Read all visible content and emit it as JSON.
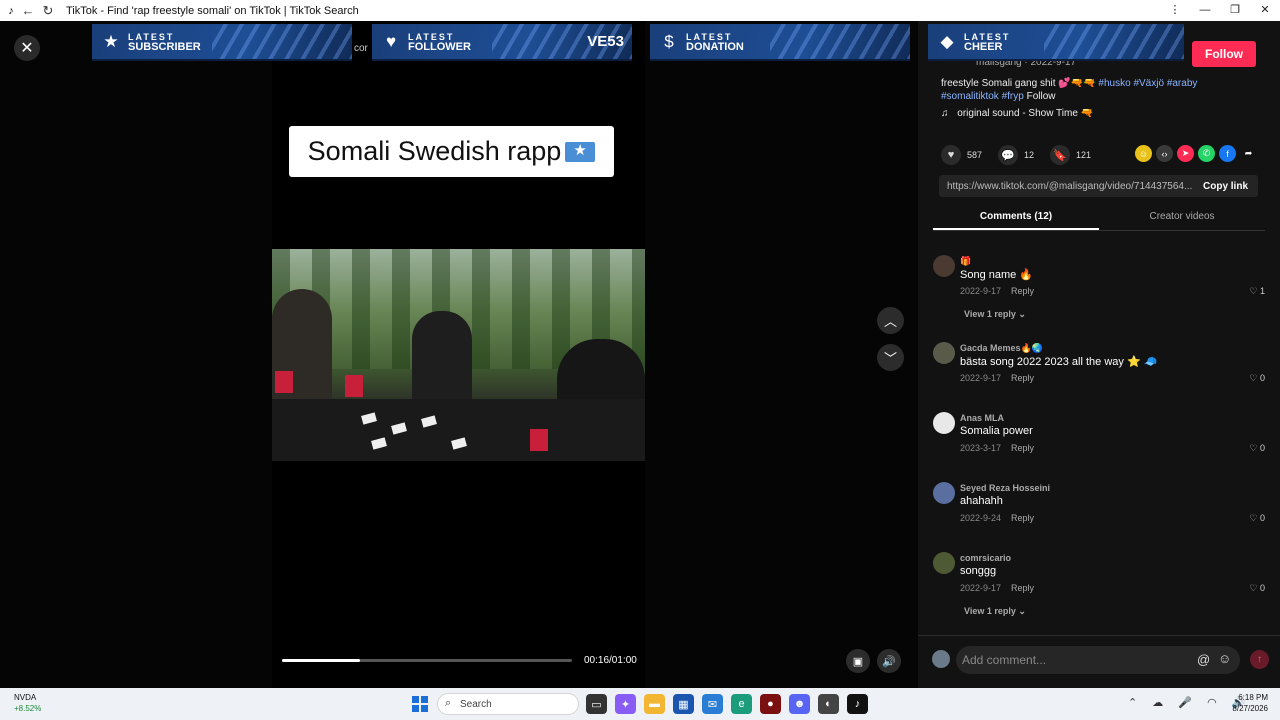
{
  "browser": {
    "title": "TikTok - Find 'rap freestyle somali' on TikTok | TikTok Search",
    "back_icon": "←",
    "reload_icon": "↻",
    "min_icon": "—",
    "max_icon": "❐",
    "close_icon": "✕",
    "more_icon": "⋮"
  },
  "overlay": {
    "banners": [
      {
        "line1": "LATEST",
        "line2": "SUBSCRIBER",
        "icon": "★",
        "value": ""
      },
      {
        "line1": "LATEST",
        "line2": "FOLLOWER",
        "icon": "♥",
        "value": "VE53"
      },
      {
        "line1": "LATEST",
        "line2": "DONATION",
        "icon": "$",
        "value": ""
      },
      {
        "line1": "LATEST",
        "line2": "CHEER",
        "icon": "◆",
        "value": ""
      }
    ],
    "peek_text": "cor"
  },
  "video": {
    "caption": "Somali Swedish rapp",
    "progress_fraction": 0.27,
    "time": "00:16/01:00"
  },
  "panel": {
    "follow_label": "Follow",
    "author_peek": "malisgang · 2022-9-17",
    "description_text": "freestyle Somali gang shit 💕🔫🔫",
    "tags": [
      "#husko",
      "#Växjö",
      "#araby",
      "#somalitiktok",
      "#fryp"
    ],
    "desc_follow": "Follow",
    "sound": "original sound - Show Time 🔫",
    "likes": "587",
    "comments": "12",
    "saves": "121",
    "url": "https://www.tiktok.com/@malisgang/video/714437564...",
    "copy_link": "Copy link",
    "tab_comments": "Comments (12)",
    "tab_creator": "Creator videos",
    "comment_placeholder": "Add comment..."
  },
  "comments": [
    {
      "user": "🎁",
      "text": "Song name 🔥",
      "date": "2022-9-17",
      "reply": "Reply",
      "likes": "1",
      "view_replies": "View 1 reply ⌄"
    },
    {
      "user": "Gacda Memes🔥🌏",
      "text": "bästa song 2022 2023 all the way ⭐ 🧢",
      "date": "2022-9-17",
      "reply": "Reply",
      "likes": "0",
      "view_replies": ""
    },
    {
      "user": "Anas MLA",
      "text": "Somalia power",
      "date": "2023-3-17",
      "reply": "Reply",
      "likes": "0",
      "view_replies": ""
    },
    {
      "user": "Seyed Reza Hosseini",
      "text": "ahahahh",
      "date": "2022-9-24",
      "reply": "Reply",
      "likes": "0",
      "view_replies": ""
    },
    {
      "user": "comrsicario",
      "text": "songgg",
      "date": "2022-9-17",
      "reply": "Reply",
      "likes": "0",
      "view_replies": "View 1 reply ⌄"
    }
  ],
  "taskbar": {
    "stock_name": "NVDA",
    "stock_change": "+8.52%",
    "search_label": "Search",
    "time": "6:18 PM",
    "date": "8/27/2026"
  },
  "colors": {
    "follow": "#fe2c55",
    "banner": "#1e4e95",
    "tag": "#8ab4ff"
  }
}
